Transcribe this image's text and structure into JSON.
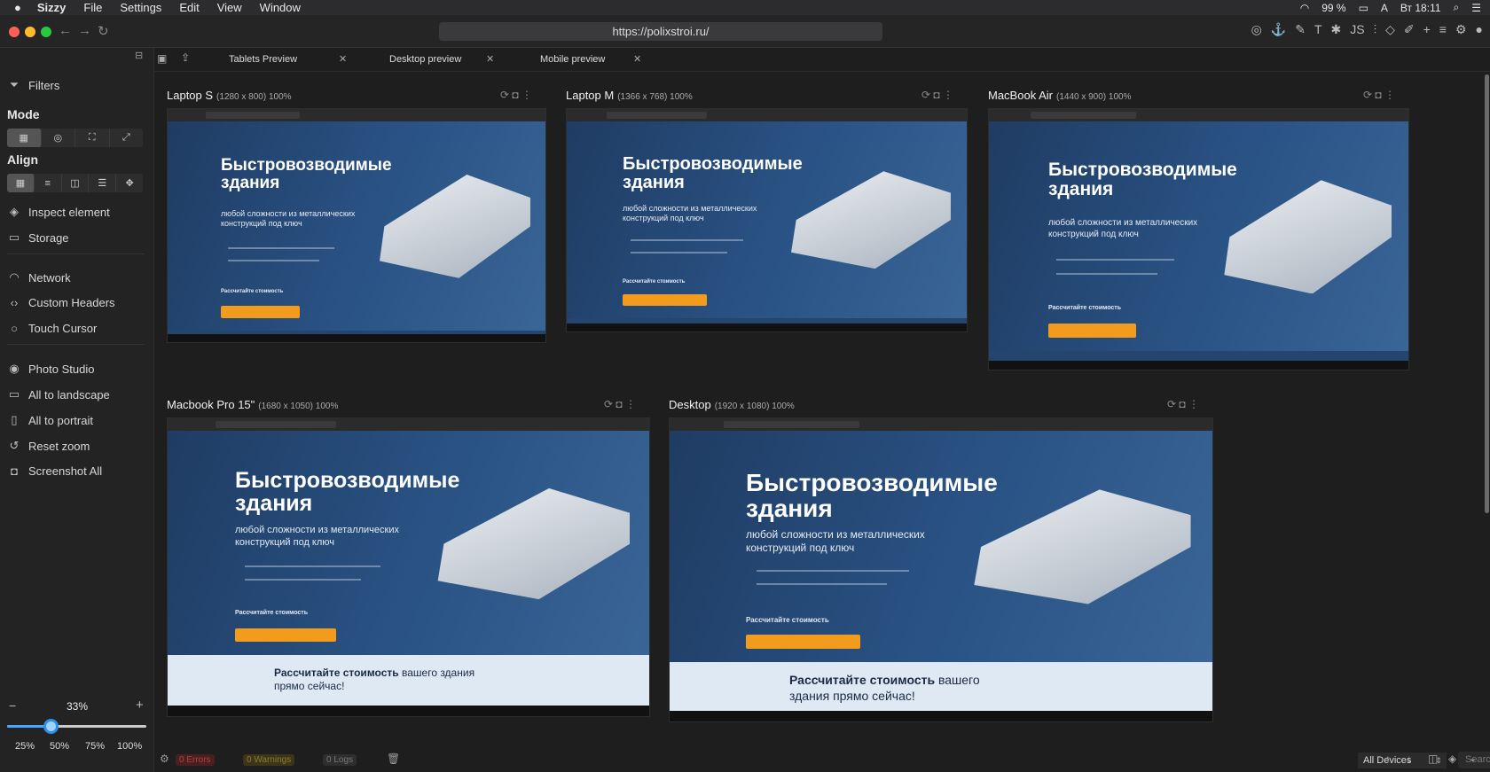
{
  "menubar": {
    "app_name": "Sizzy",
    "menus": [
      "File",
      "Settings",
      "Edit",
      "View",
      "Window"
    ],
    "battery": "99 %",
    "time": "Вт 18:11"
  },
  "toolbar": {
    "url": "https://polixstroi.ru/"
  },
  "tabs": [
    {
      "label": "Tablets Preview"
    },
    {
      "label": "Desktop preview"
    },
    {
      "label": "Mobile preview"
    }
  ],
  "sidebar": {
    "filters": "Filters",
    "mode_heading": "Mode",
    "align_heading": "Align",
    "items_group1": [
      "Inspect element",
      "Storage"
    ],
    "items_group2": [
      "Network",
      "Custom Headers",
      "Touch Cursor"
    ],
    "items_group3": [
      "Photo Studio",
      "All to landscape",
      "All to portrait",
      "Reset zoom",
      "Screenshot All"
    ],
    "zoom": {
      "value": "33%",
      "minus": "−",
      "plus": "+",
      "presets": [
        "25%",
        "50%",
        "75%",
        "100%"
      ],
      "level": 0.31
    }
  },
  "devices": [
    {
      "name": "Laptop S",
      "res": "(1280 x 800) 100%"
    },
    {
      "name": "Laptop M",
      "res": "(1366 x 768) 100%"
    },
    {
      "name": "MacBook Air",
      "res": "(1440 x 900) 100%"
    },
    {
      "name": "Macbook Pro 15\"",
      "res": "(1680 x 1050) 100%"
    },
    {
      "name": "Desktop",
      "res": "(1920 x 1080) 100%"
    }
  ],
  "site": {
    "heading": "Быстровозводимые здания",
    "sub": "любой сложности из металлических конструкций под ключ",
    "cta_bold": "Рассчитайте стоимость",
    "cta_rest": "вашего здания прямо сейчас!"
  },
  "statusbar": {
    "errors": "0 Errors",
    "warnings": "0 Warnings",
    "logs": "0 Logs",
    "device_select": "All Devices",
    "search_placeholder": "Search..."
  }
}
